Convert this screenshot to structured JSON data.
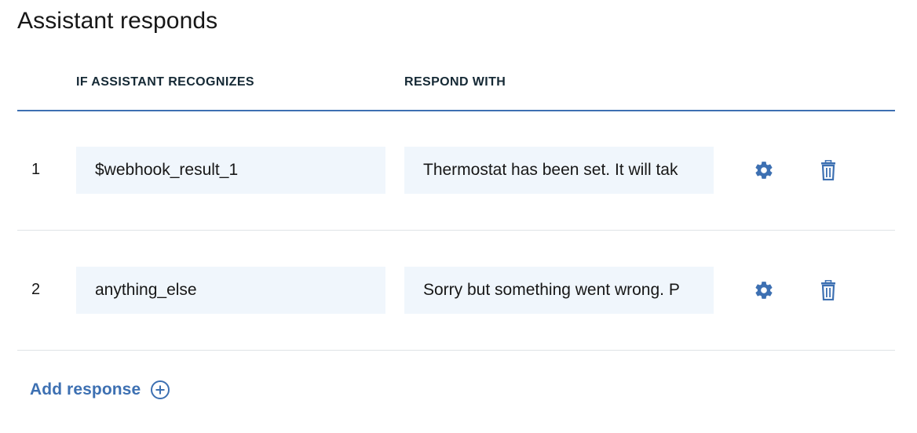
{
  "section": {
    "title": "Assistant responds"
  },
  "columns": {
    "condition": "IF ASSISTANT RECOGNIZES",
    "response": "RESPOND WITH"
  },
  "rows": [
    {
      "number": "1",
      "condition": "$webhook_result_1",
      "response": "Thermostat has been set. It will tak"
    },
    {
      "number": "2",
      "condition": "anything_else",
      "response": "Sorry but something went wrong. P"
    }
  ],
  "actions": {
    "add_response": "Add response"
  },
  "icons": {
    "settings": "gear-icon",
    "delete": "trash-icon",
    "add": "plus-circle-icon"
  },
  "colors": {
    "accent": "#3d70b2",
    "field_bg": "#f0f6fc",
    "divider": "#dfe3e6"
  }
}
